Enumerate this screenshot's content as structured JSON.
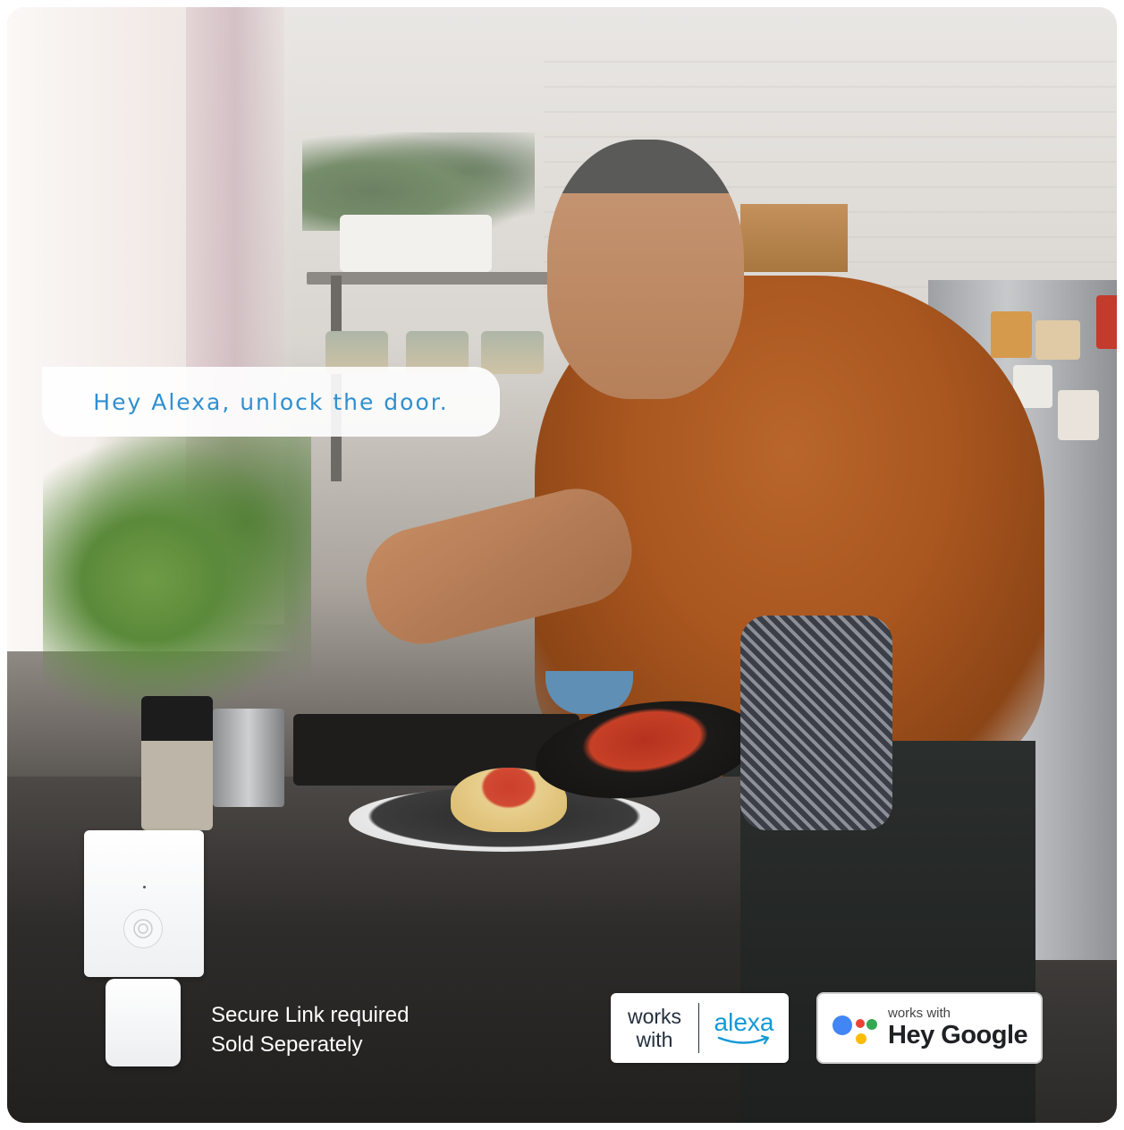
{
  "speech": {
    "text": "Hey Alexa, unlock the door."
  },
  "caption": {
    "line1": "Secure Link required",
    "line2": "Sold Seperately"
  },
  "alexa_badge": {
    "works": "works",
    "with": "with",
    "brand": "alexa"
  },
  "google_badge": {
    "small": "works with",
    "big": "Hey Google"
  },
  "colors": {
    "speech_text": "#2f8fd0",
    "alexa_blue": "#1399d6",
    "google_blue": "#4285f4",
    "google_red": "#ea4335",
    "google_yellow": "#fbbc05",
    "google_green": "#34a853",
    "shirt": "#a9561f"
  }
}
